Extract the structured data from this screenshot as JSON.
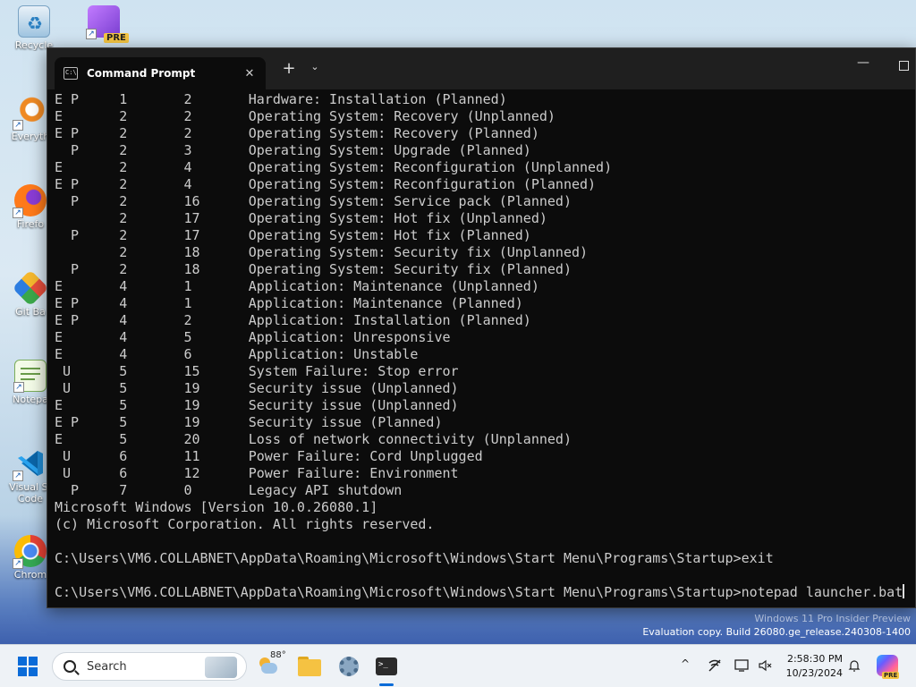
{
  "desktop": {
    "icons": [
      {
        "name": "recycle-bin",
        "label": "Recycle"
      },
      {
        "name": "visual-studio-preview",
        "label": "",
        "badge": "PRE"
      },
      {
        "name": "everything",
        "label": "Everyth"
      },
      {
        "name": "firefox",
        "label": "Firefo"
      },
      {
        "name": "git-bash",
        "label": "Git Ba"
      },
      {
        "name": "notepad",
        "label": "Notepa"
      },
      {
        "name": "visual-studio-code",
        "label": "Visual St Code"
      },
      {
        "name": "chrome",
        "label": "Chrom"
      }
    ]
  },
  "terminal": {
    "tab_title": "Command Prompt",
    "tab_icon": "C:\\",
    "close_glyph": "✕",
    "newtab_glyph": "+",
    "dropdown_glyph": "⌄",
    "minimize_glyph": "—",
    "lines": [
      "E P     1       2       Hardware: Installation (Planned)",
      "E       2       2       Operating System: Recovery (Unplanned)",
      "E P     2       2       Operating System: Recovery (Planned)",
      "  P     2       3       Operating System: Upgrade (Planned)",
      "E       2       4       Operating System: Reconfiguration (Unplanned)",
      "E P     2       4       Operating System: Reconfiguration (Planned)",
      "  P     2       16      Operating System: Service pack (Planned)",
      "        2       17      Operating System: Hot fix (Unplanned)",
      "  P     2       17      Operating System: Hot fix (Planned)",
      "        2       18      Operating System: Security fix (Unplanned)",
      "  P     2       18      Operating System: Security fix (Planned)",
      "E       4       1       Application: Maintenance (Unplanned)",
      "E P     4       1       Application: Maintenance (Planned)",
      "E P     4       2       Application: Installation (Planned)",
      "E       4       5       Application: Unresponsive",
      "E       4       6       Application: Unstable",
      " U      5       15      System Failure: Stop error",
      " U      5       19      Security issue (Unplanned)",
      "E       5       19      Security issue (Unplanned)",
      "E P     5       19      Security issue (Planned)",
      "E       5       20      Loss of network connectivity (Unplanned)",
      " U      6       11      Power Failure: Cord Unplugged",
      " U      6       12      Power Failure: Environment",
      "  P     7       0       Legacy API shutdown",
      "Microsoft Windows [Version 10.0.26080.1]",
      "(c) Microsoft Corporation. All rights reserved.",
      "",
      "C:\\Users\\VM6.COLLABNET\\AppData\\Roaming\\Microsoft\\Windows\\Start Menu\\Programs\\Startup>exit",
      "",
      "C:\\Users\\VM6.COLLABNET\\AppData\\Roaming\\Microsoft\\Windows\\Start Menu\\Programs\\Startup>notepad launcher.bat"
    ]
  },
  "watermark": {
    "line1": "Windows 11 Pro Insider Preview",
    "line2": "Evaluation copy. Build 26080.ge_release.240308-1400"
  },
  "taskbar": {
    "search_placeholder": "Search",
    "weather_temp": "88°",
    "tray_chevron": "^",
    "clock_time": "2:58:30 PM",
    "clock_date": "10/23/2024",
    "copilot_badge": "PRE",
    "accent": "#0a6bd8"
  }
}
